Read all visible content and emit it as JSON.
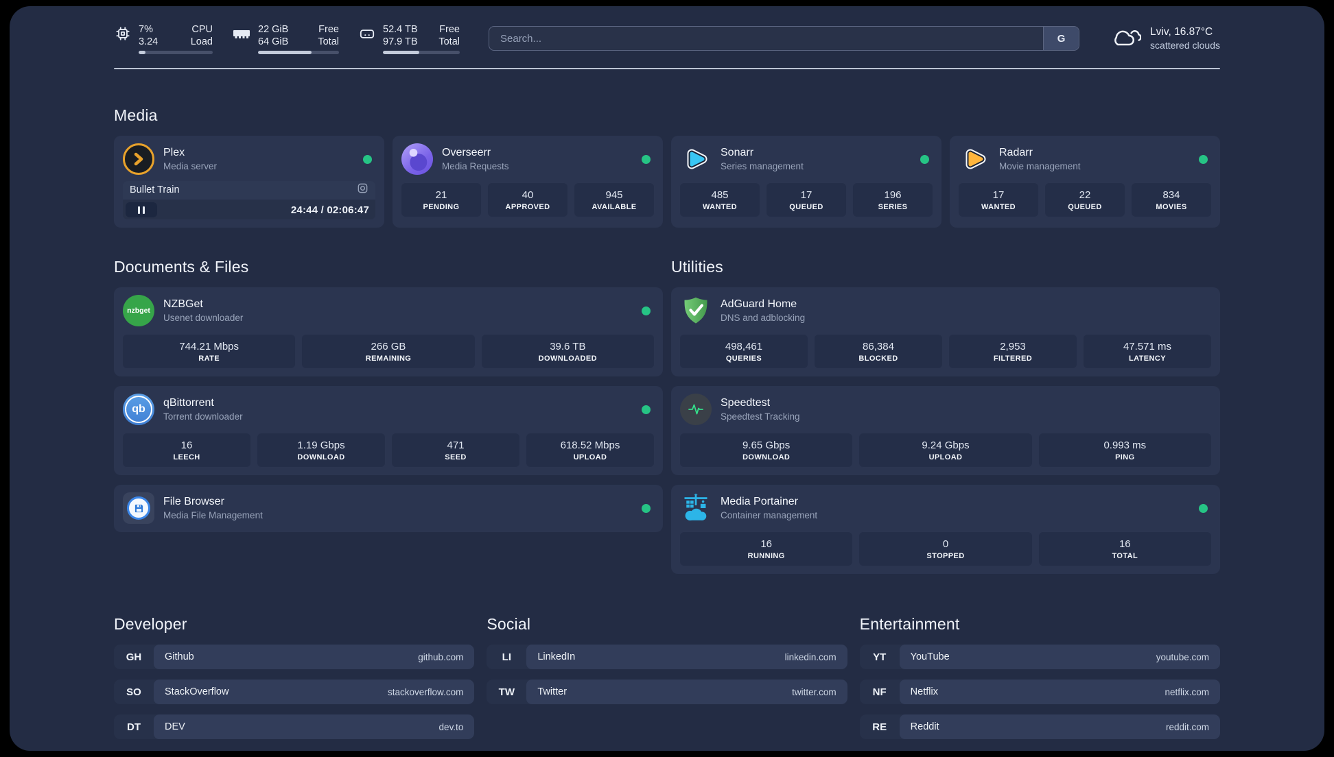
{
  "header": {
    "stats": {
      "cpu": {
        "value1": "7%",
        "value2": "3.24",
        "label1": "CPU",
        "label2": "Load",
        "percent": 9
      },
      "memory": {
        "value1": "22 GiB",
        "value2": "64 GiB",
        "label1": "Free",
        "label2": "Total",
        "percent": 66
      },
      "storage": {
        "value1": "52.4 TB",
        "value2": "97.9 TB",
        "label1": "Free",
        "label2": "Total",
        "percent": 47
      }
    },
    "search": {
      "placeholder": "Search...",
      "button_label": "G"
    },
    "weather": {
      "location": "Lviv, 16.87°C",
      "condition": "scattered clouds"
    }
  },
  "sections": {
    "media": {
      "title": "Media",
      "plex": {
        "name": "Plex",
        "description": "Media server",
        "now_playing": "Bullet Train",
        "time": "24:44 / 02:06:47"
      },
      "overseerr": {
        "name": "Overseerr",
        "description": "Media Requests",
        "stats": [
          {
            "value": "21",
            "label": "PENDING"
          },
          {
            "value": "40",
            "label": "APPROVED"
          },
          {
            "value": "945",
            "label": "AVAILABLE"
          }
        ]
      },
      "sonarr": {
        "name": "Sonarr",
        "description": "Series management",
        "stats": [
          {
            "value": "485",
            "label": "WANTED"
          },
          {
            "value": "17",
            "label": "QUEUED"
          },
          {
            "value": "196",
            "label": "SERIES"
          }
        ]
      },
      "radarr": {
        "name": "Radarr",
        "description": "Movie management",
        "stats": [
          {
            "value": "17",
            "label": "WANTED"
          },
          {
            "value": "22",
            "label": "QUEUED"
          },
          {
            "value": "834",
            "label": "MOVIES"
          }
        ]
      }
    },
    "documents": {
      "title": "Documents & Files",
      "nzbget": {
        "name": "NZBGet",
        "description": "Usenet downloader",
        "logo_text": "nzbget",
        "stats": [
          {
            "value": "744.21 Mbps",
            "label": "RATE"
          },
          {
            "value": "266 GB",
            "label": "REMAINING"
          },
          {
            "value": "39.6 TB",
            "label": "DOWNLOADED"
          }
        ]
      },
      "qbittorrent": {
        "name": "qBittorrent",
        "description": "Torrent downloader",
        "logo_text": "qb",
        "stats": [
          {
            "value": "16",
            "label": "LEECH"
          },
          {
            "value": "1.19 Gbps",
            "label": "DOWNLOAD"
          },
          {
            "value": "471",
            "label": "SEED"
          },
          {
            "value": "618.52 Mbps",
            "label": "UPLOAD"
          }
        ]
      },
      "filebrowser": {
        "name": "File Browser",
        "description": "Media File Management"
      }
    },
    "utilities": {
      "title": "Utilities",
      "adguard": {
        "name": "AdGuard Home",
        "description": "DNS and adblocking",
        "stats": [
          {
            "value": "498,461",
            "label": "QUERIES"
          },
          {
            "value": "86,384",
            "label": "BLOCKED"
          },
          {
            "value": "2,953",
            "label": "FILTERED"
          },
          {
            "value": "47.571 ms",
            "label": "LATENCY"
          }
        ]
      },
      "speedtest": {
        "name": "Speedtest",
        "description": "Speedtest Tracking",
        "stats": [
          {
            "value": "9.65 Gbps",
            "label": "DOWNLOAD"
          },
          {
            "value": "9.24 Gbps",
            "label": "UPLOAD"
          },
          {
            "value": "0.993 ms",
            "label": "PING"
          }
        ]
      },
      "portainer": {
        "name": "Media Portainer",
        "description": "Container management",
        "stats": [
          {
            "value": "16",
            "label": "RUNNING"
          },
          {
            "value": "0",
            "label": "STOPPED"
          },
          {
            "value": "16",
            "label": "TOTAL"
          }
        ]
      }
    },
    "developer": {
      "title": "Developer",
      "links": [
        {
          "abbr": "GH",
          "name": "Github",
          "url": "github.com"
        },
        {
          "abbr": "SO",
          "name": "StackOverflow",
          "url": "stackoverflow.com"
        },
        {
          "abbr": "DT",
          "name": "DEV",
          "url": "dev.to"
        }
      ]
    },
    "social": {
      "title": "Social",
      "links": [
        {
          "abbr": "LI",
          "name": "LinkedIn",
          "url": "linkedin.com"
        },
        {
          "abbr": "TW",
          "name": "Twitter",
          "url": "twitter.com"
        }
      ]
    },
    "entertainment": {
      "title": "Entertainment",
      "links": [
        {
          "abbr": "YT",
          "name": "YouTube",
          "url": "youtube.com"
        },
        {
          "abbr": "NF",
          "name": "Netflix",
          "url": "netflix.com"
        },
        {
          "abbr": "RE",
          "name": "Reddit",
          "url": "reddit.com"
        }
      ]
    }
  },
  "colors": {
    "page_background": "#232c44",
    "card_background": "#2b3550",
    "status_online": "#26c485",
    "sonarr_accent": "#38c6f4",
    "radarr_accent": "#ffb53c",
    "plex_accent": "#e8a22b",
    "adguard_accent": "#5cb85f",
    "portainer_accent": "#2cb5e8"
  }
}
